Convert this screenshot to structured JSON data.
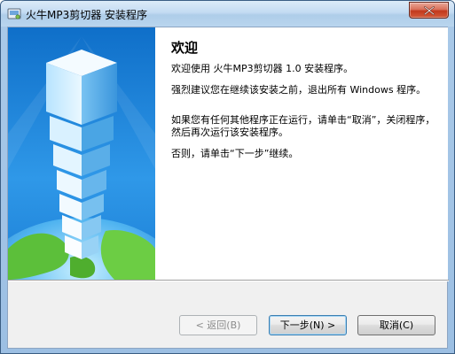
{
  "window": {
    "title": "火牛MP3剪切器 安装程序",
    "icon": "installer-icon"
  },
  "content": {
    "heading": "欢迎",
    "paragraphs": [
      "欢迎使用 火牛MP3剪切器 1.0 安装程序。",
      "强烈建议您在继续该安装之前，退出所有 Windows 程序。",
      "如果您有任何其他程序正在运行，请单击“取消”，关闭程序，然后再次运行该安装程序。",
      "否则，请单击“下一步”继续。"
    ]
  },
  "buttons": {
    "back": "< 返回(B)",
    "next": "下一步(N) >",
    "cancel": "取消(C)"
  },
  "colors": {
    "banner_blue": "#1b7fd6",
    "close_red": "#c2391d"
  }
}
